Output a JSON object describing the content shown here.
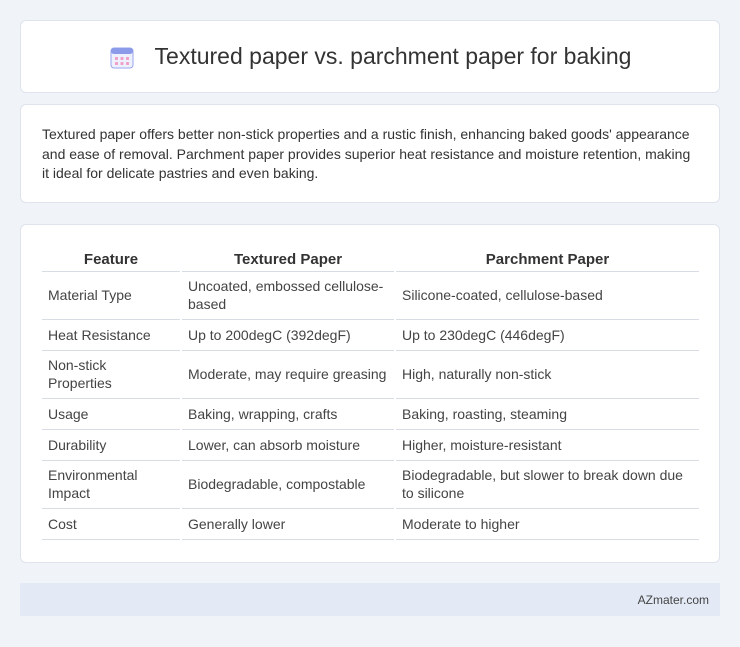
{
  "page": {
    "title": "Textured paper vs. parchment paper for baking",
    "summary": "Textured paper offers better non-stick properties and a rustic finish, enhancing baked goods' appearance and ease of removal. Parchment paper provides superior heat resistance and moisture retention, making it ideal for delicate pastries and even baking."
  },
  "table": {
    "headers": [
      "Feature",
      "Textured Paper",
      "Parchment Paper"
    ],
    "rows": [
      [
        "Material Type",
        "Uncoated, embossed cellulose-based",
        "Silicone-coated, cellulose-based"
      ],
      [
        "Heat Resistance",
        "Up to 200degC (392degF)",
        "Up to 230degC (446degF)"
      ],
      [
        "Non-stick Properties",
        "Moderate, may require greasing",
        "High, naturally non-stick"
      ],
      [
        "Usage",
        "Baking, wrapping, crafts",
        "Baking, roasting, steaming"
      ],
      [
        "Durability",
        "Lower, can absorb moisture",
        "Higher, moisture-resistant"
      ],
      [
        "Environmental Impact",
        "Biodegradable, compostable",
        "Biodegradable, but slower to break down due to silicone"
      ],
      [
        "Cost",
        "Generally lower",
        "Moderate to higher"
      ]
    ]
  },
  "footer": {
    "brand": "AZmater.com"
  },
  "icons": {
    "title_icon": "calendar-icon"
  },
  "colors": {
    "background": "#f0f3f8",
    "footer_bg": "#e3eaf5",
    "icon_accent": "#7b8ce8"
  }
}
